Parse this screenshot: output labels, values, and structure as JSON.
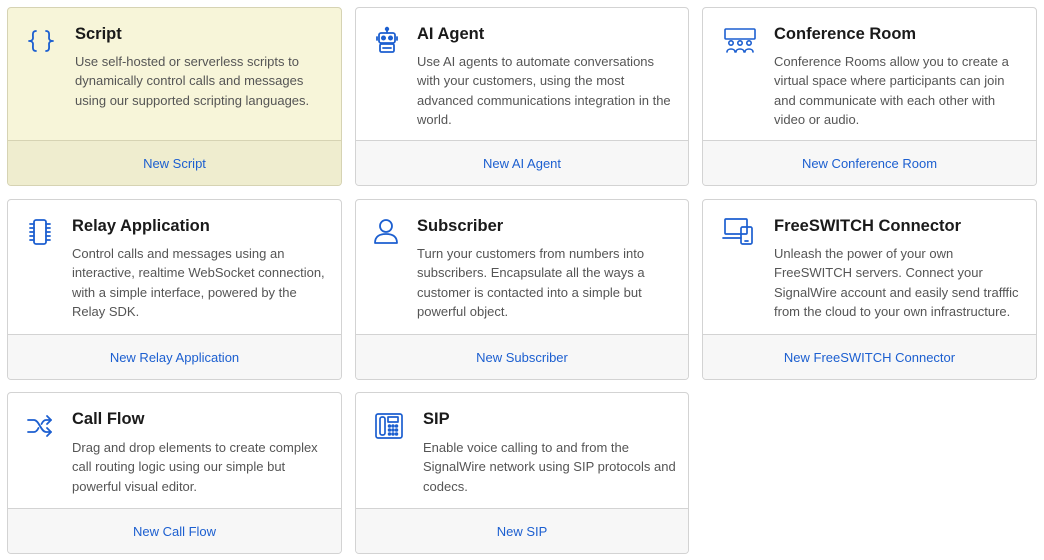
{
  "colors": {
    "accent": "#1c5fd0",
    "highlight_bg": "#f7f5d9",
    "footer_bg": "#f7f7f7"
  },
  "cards": [
    {
      "icon": "curly-braces-icon",
      "title": "Script",
      "description": "Use self-hosted or serverless scripts to dynamically control calls and messages using our supported scripting languages.",
      "action": "New Script",
      "highlighted": true
    },
    {
      "icon": "robot-icon",
      "title": "AI Agent",
      "description": "Use AI agents to automate conversations with your customers, using the most advanced communications integration in the world.",
      "action": "New AI Agent"
    },
    {
      "icon": "conference-room-icon",
      "title": "Conference Room",
      "description": "Conference Rooms allow you to create a virtual space where participants can join and communicate with each other with video or audio.",
      "action": "New Conference Room"
    },
    {
      "icon": "chip-icon",
      "title": "Relay Application",
      "description": "Control calls and messages using an interactive, realtime WebSocket connection, with a simple interface, powered by the Relay SDK.",
      "action": "New Relay Application"
    },
    {
      "icon": "user-icon",
      "title": "Subscriber",
      "description": "Turn your customers from numbers into subscribers. Encapsulate all the ways a customer is contacted into a simple but powerful object.",
      "action": "New Subscriber"
    },
    {
      "icon": "devices-icon",
      "title": "FreeSWITCH Connector",
      "description": "Unleash the power of your own FreeSWITCH servers. Connect your SignalWire account and easily send trafffic from the cloud to your own infrastructure.",
      "action": "New FreeSWITCH Connector"
    },
    {
      "icon": "shuffle-icon",
      "title": "Call Flow",
      "description": "Drag and drop elements to create complex call routing logic using our simple but powerful visual editor.",
      "action": "New Call Flow"
    },
    {
      "icon": "desk-phone-icon",
      "title": "SIP",
      "description": "Enable voice calling to and from the SignalWire network using SIP protocols and codecs.",
      "action": "New SIP"
    }
  ]
}
